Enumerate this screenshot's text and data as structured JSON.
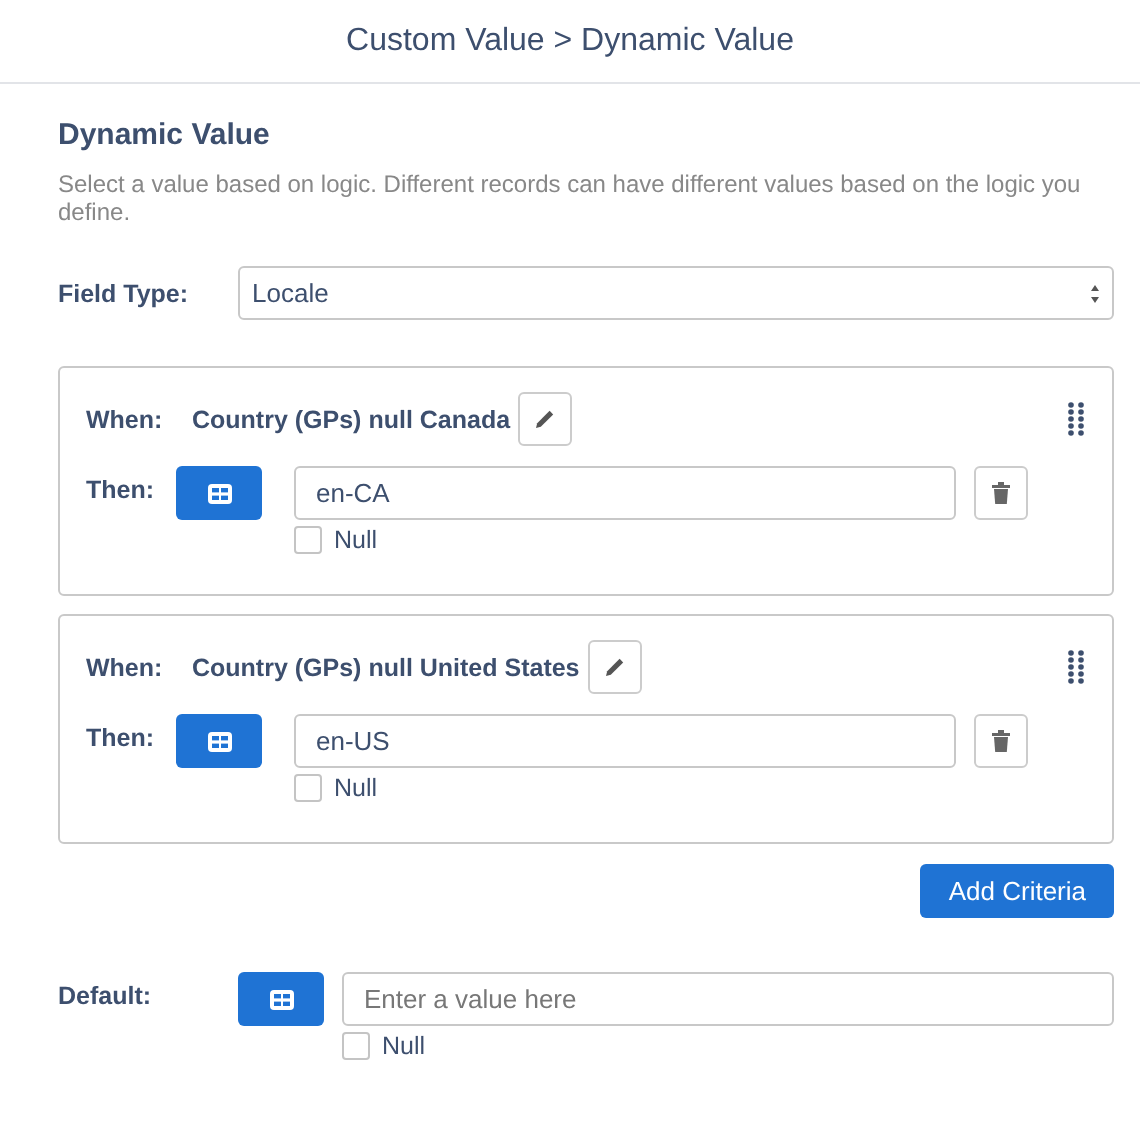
{
  "header": {
    "title": "Custom Value > Dynamic Value"
  },
  "heading": "Dynamic Value",
  "description": "Select a value based on logic. Different records can have different values based on the logic you define.",
  "field_type": {
    "label": "Field Type:",
    "value": "Locale"
  },
  "criteria": [
    {
      "when_label": "When:",
      "condition": "Country (GPs) null Canada",
      "then_label": "Then:",
      "value": "en-CA",
      "null_label": "Null",
      "null_checked": false
    },
    {
      "when_label": "When:",
      "condition": "Country (GPs) null United States",
      "then_label": "Then:",
      "value": "en-US",
      "null_label": "Null",
      "null_checked": false
    }
  ],
  "add_button": "Add Criteria",
  "default": {
    "label": "Default:",
    "placeholder": "Enter a value here",
    "null_label": "Null",
    "null_checked": false
  }
}
